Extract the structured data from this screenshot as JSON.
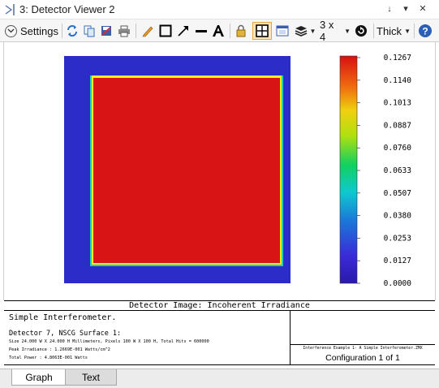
{
  "window": {
    "title": "3: Detector Viewer 2",
    "buttons": {
      "pin": "↓",
      "menu": "▾",
      "close": "✕"
    }
  },
  "toolbar": {
    "settings_label": "Settings",
    "layout_label": "3 x 4",
    "thickness_label": "Thick",
    "icons": [
      "refresh-icon",
      "copy-icon",
      "save-icon",
      "print-icon",
      "pencil-icon",
      "rectangle-icon",
      "arrow-icon",
      "line-icon",
      "text-icon",
      "lock-icon",
      "crosshair-icon",
      "window-icon",
      "layers-icon",
      "circle-arrow-icon",
      "help-icon"
    ]
  },
  "plot": {
    "legend_ticks": [
      "0.1267",
      "0.1140",
      "0.1013",
      "0.0887",
      "0.0760",
      "0.0633",
      "0.0507",
      "0.0380",
      "0.0253",
      "0.0127",
      "0.0000"
    ],
    "colors": {
      "background": "#2c2cc8",
      "field": "#d81414",
      "edge_yellow": "#f0f020",
      "edge_cyan": "#20d0b0"
    }
  },
  "caption": "Detector Image: Incoherent Irradiance",
  "info": {
    "title": "Simple Interferometer.",
    "subtitle": "Detector 7, NSCG Surface 1:",
    "lines": [
      "Size 24.000 W X 24.000 H Millimeters, Pixels 100 W X 100 H, Total Hits = 600000",
      "Peak Irradiance : 1.2669E-001 Watts/cm^2",
      "Total Power     : 4.8063E-001 Watts"
    ],
    "file": "Interference Example 1- A Simple Interferometer.ZMX",
    "config": "Configuration 1 of 1"
  },
  "tabs": {
    "graph": "Graph",
    "text": "Text"
  }
}
